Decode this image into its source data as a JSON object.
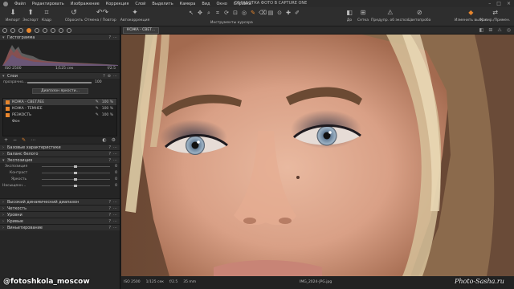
{
  "menubar": {
    "items": [
      "Файл",
      "Редактировать",
      "Изображение",
      "Коррекция",
      "Слой",
      "Выделить",
      "Камера",
      "Вид",
      "Окно",
      "Справка"
    ],
    "title": "ОБРАБОТКА ФОТО В CAPTURE ONE"
  },
  "toolbar": {
    "import": "Импорт",
    "export": "Экспорт",
    "crop": "Кадр",
    "reset": "Сбросить",
    "undo_redo": "Отмена / Повтор",
    "auto": "Автокоррекция",
    "cursor_tools": "Инструменты курсора",
    "before": "До",
    "grid": "Сетка",
    "warn": "Предупр. об экспоз.",
    "picker": "Цветопроба",
    "apply_sel": "Изменить выбр.е",
    "copy_apply": "Копир./Примен."
  },
  "left_panel": {
    "histogram": {
      "title": "Гистограмма",
      "iso": "ISO 2500",
      "shutter": "1/125 сек",
      "aperture": "f/2.5"
    },
    "layers": {
      "title": "Слои",
      "opacity_label": "прозрачно...",
      "opacity_value": "100",
      "range_button": "Диапазон яркости...",
      "items": [
        {
          "name": "КОЖА - СВЕТЛЕЕ",
          "pct": "100 %"
        },
        {
          "name": "КОЖА - ТЕМНЕЕ",
          "pct": "100 %"
        },
        {
          "name": "РЕЗКОСТЬ",
          "pct": "100 %"
        },
        {
          "name": "Фон",
          "pct": ""
        }
      ]
    },
    "sections": {
      "base": "Базовые характеристики",
      "wb": "Баланс белого",
      "exposure": "Экспозиция",
      "hdr": "Высокий динамический диапазон",
      "clarity": "Четкость",
      "levels": "Уровни",
      "curves": "Кривые",
      "vignette": "Виньетирование"
    },
    "exposure_sliders": [
      {
        "label": "Экспозиция",
        "value": "0"
      },
      {
        "label": "Контраст",
        "value": "0"
      },
      {
        "label": "Яркость",
        "value": "0"
      },
      {
        "label": "Насыщенн...",
        "value": "0"
      }
    ]
  },
  "viewer": {
    "layer_chip": "КОЖА - СВЕТ...",
    "status_iso": "ISO 2500",
    "status_shutter": "1/125 сек",
    "status_aperture": "f/2.5",
    "status_focal": "35 mm",
    "filename": "IMG_2024-JPG.jpg"
  },
  "watermarks": {
    "left": "@fotoshkola_moscow",
    "right": "Photo-Sasha.ru"
  },
  "colors": {
    "accent": "#e8862d",
    "panel": "#262626"
  }
}
